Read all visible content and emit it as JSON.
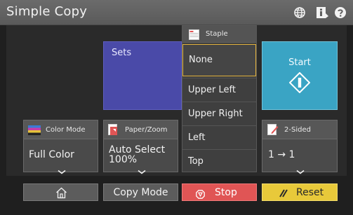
{
  "header": {
    "title": "Simple Copy",
    "icons": [
      "globe-icon",
      "info-icon",
      "help-icon"
    ]
  },
  "sets": {
    "label": "Sets"
  },
  "start": {
    "label": "Start"
  },
  "staple": {
    "title": "Staple",
    "options": [
      "None",
      "Upper Left",
      "Upper Right",
      "Left",
      "Top"
    ],
    "selected": "None"
  },
  "color_mode": {
    "title": "Color Mode",
    "value": "Full Color"
  },
  "paper_zoom": {
    "title": "Paper/Zoom",
    "value_line1": "Auto Select",
    "value_line2": "100%"
  },
  "two_sided": {
    "title": "2-Sided",
    "value": "1 → 1"
  },
  "bottom": {
    "copy_mode": "Copy Mode",
    "stop": "Stop",
    "reset": "Reset"
  },
  "colors": {
    "header": "#5f5f5f",
    "sets": "#4a4aa8",
    "start": "#3aa4c4",
    "stop": "#e05555",
    "reset": "#e8c93a",
    "selected_outline": "#e3b23c"
  }
}
